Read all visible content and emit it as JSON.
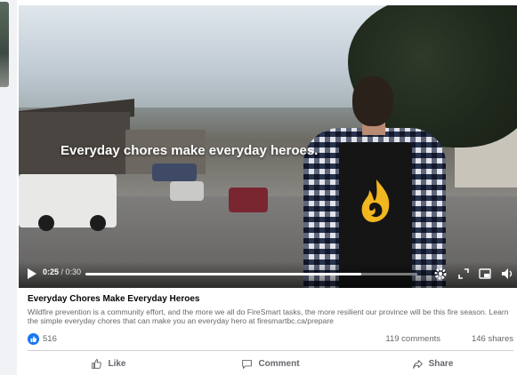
{
  "video": {
    "overlay_caption": "Everyday chores make everyday heroes.",
    "current_time": "0:25",
    "duration": "0:30",
    "progress": 0.83,
    "play_icon": "play-icon",
    "settings_icon": "gear-icon",
    "fullscreen_icon": "fullscreen-icon",
    "pip_icon": "picture-in-picture-icon",
    "volume_icon": "volume-icon"
  },
  "post": {
    "title": "Everyday Chores Make Everyday Heroes",
    "description": "Wildfire prevention is a community effort, and the more we all do FireSmart tasks, the more resilient our province will be this fire season. Learn the simple everyday chores that can make you an everyday hero at firesmartbc.ca/prepare"
  },
  "stats": {
    "likes": "516",
    "comments": "119 comments",
    "shares": "146 shares"
  },
  "actions": {
    "like": "Like",
    "comment": "Comment",
    "share": "Share"
  },
  "colors": {
    "accent": "#1877f2",
    "apron_logo": "#f2b61f"
  }
}
